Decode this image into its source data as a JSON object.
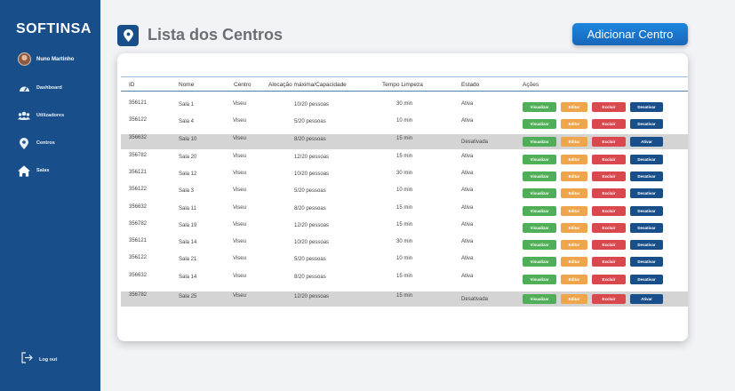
{
  "sidebar": {
    "brand": "SOFTINSA",
    "user_name": "Nuno Martinho",
    "items": [
      {
        "label": "Dashboard",
        "icon": "gauge-icon"
      },
      {
        "label": "Utilizadores",
        "icon": "users-icon"
      },
      {
        "label": "Centros",
        "icon": "map-pin-icon"
      },
      {
        "label": "Salas",
        "icon": "home-icon"
      }
    ],
    "logout_label": "Log out"
  },
  "header": {
    "title": "Lista dos Centros",
    "add_button": "Adicionar Centro"
  },
  "table": {
    "headers": [
      "ID",
      "Nome",
      "Centro",
      "Alocação máxima/Capacidade",
      "Tempo Limpeza",
      "Estado",
      "Ações"
    ],
    "actions": {
      "view": "Visualizar",
      "edit": "Editar",
      "delete": "Excluir",
      "deactivate": "Desativar",
      "activate": "Ativar"
    },
    "rows": [
      {
        "id": "356121",
        "nome": "Sala 1",
        "centro": "Viseu",
        "alocacao": "10/20 pessoas",
        "tempo": "30 min",
        "estado": "Ativa",
        "inactive": false
      },
      {
        "id": "356122",
        "nome": "Sala 4",
        "centro": "Viseu",
        "alocacao": "5/20 pessoas",
        "tempo": "10 min",
        "estado": "Ativa",
        "inactive": false
      },
      {
        "id": "356632",
        "nome": "Sala 10",
        "centro": "Viseu",
        "alocacao": "8/20 pessoas",
        "tempo": "15 min",
        "estado": "Desativada",
        "inactive": true
      },
      {
        "id": "356782",
        "nome": "Sala 20",
        "centro": "Viseu",
        "alocacao": "12/20 pessoas",
        "tempo": "15 min",
        "estado": "Ativa",
        "inactive": false
      },
      {
        "id": "356121",
        "nome": "Sala 12",
        "centro": "Viseu",
        "alocacao": "10/20 pessoas",
        "tempo": "30 min",
        "estado": "Ativa",
        "inactive": false
      },
      {
        "id": "356122",
        "nome": "Sala 3",
        "centro": "Viseu",
        "alocacao": "5/20 pessoas",
        "tempo": "10 min",
        "estado": "Ativa",
        "inactive": false
      },
      {
        "id": "356632",
        "nome": "Sala 11",
        "centro": "Viseu",
        "alocacao": "8/20 pessoas",
        "tempo": "15 min",
        "estado": "Ativa",
        "inactive": false
      },
      {
        "id": "356782",
        "nome": "Sala 19",
        "centro": "Viseu",
        "alocacao": "12/20 pessoas",
        "tempo": "15 min",
        "estado": "Ativa",
        "inactive": false
      },
      {
        "id": "356121",
        "nome": "Sala 14",
        "centro": "Viseu",
        "alocacao": "10/20 pessoas",
        "tempo": "30 min",
        "estado": "Ativa",
        "inactive": false
      },
      {
        "id": "356122",
        "nome": "Sala 21",
        "centro": "Viseu",
        "alocacao": "5/20 pessoas",
        "tempo": "10 min",
        "estado": "Ativa",
        "inactive": false
      },
      {
        "id": "356632",
        "nome": "Sala 14",
        "centro": "Viseu",
        "alocacao": "8/20 pessoas",
        "tempo": "15 min",
        "estado": "Ativa",
        "inactive": false
      },
      {
        "id": "356782",
        "nome": "Sala 25",
        "centro": "Viseu",
        "alocacao": "12/20 pessoas",
        "tempo": "15 min",
        "estado": "Desativada",
        "inactive": true
      }
    ]
  },
  "colors": {
    "sidebar": "#184e8a",
    "view": "#4fae57",
    "edit": "#eea54b",
    "delete": "#d9484d",
    "deactivate": "#184e8a",
    "inactive_row": "#d4d4d4"
  }
}
